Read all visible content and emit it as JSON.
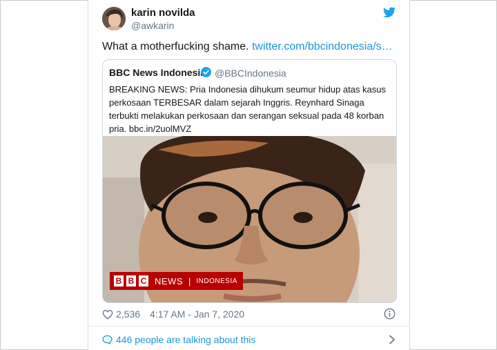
{
  "author": {
    "name": "karin novilda",
    "handle": "@awkarin"
  },
  "tweet": {
    "text": "What a motherfucking shame. ",
    "link": "twitter.com/bbcindonesia/s…"
  },
  "quoted": {
    "name": "BBC News Indonesia",
    "handle": "@BBCIndonesia",
    "text": "BREAKING NEWS: Pria Indonesia dihukum seumur hidup atas kasus perkosaan TERBESAR dalam sejarah Inggris. Reynhard Sinaga terbukti melakukan perkosaan dan serangan seksual pada 48 korban pria. bbc.in/2uolMVZ",
    "banner": {
      "b1": "B",
      "b2": "B",
      "b3": "C",
      "news": "NEWS",
      "sep": "|",
      "region": "INDONESIA"
    }
  },
  "meta": {
    "likes": "2,536",
    "timestamp": "4:17 AM - Jan 7, 2020"
  },
  "footer": {
    "talking": "446 people are talking about this"
  },
  "colors": {
    "accent": "#1b95e0",
    "bbc_red": "#b80000",
    "muted": "#657786"
  },
  "icons": [
    "twitter-bird-icon",
    "verified-icon",
    "heart-icon",
    "info-icon",
    "speech-bubble-icon",
    "chevron-right-icon"
  ]
}
